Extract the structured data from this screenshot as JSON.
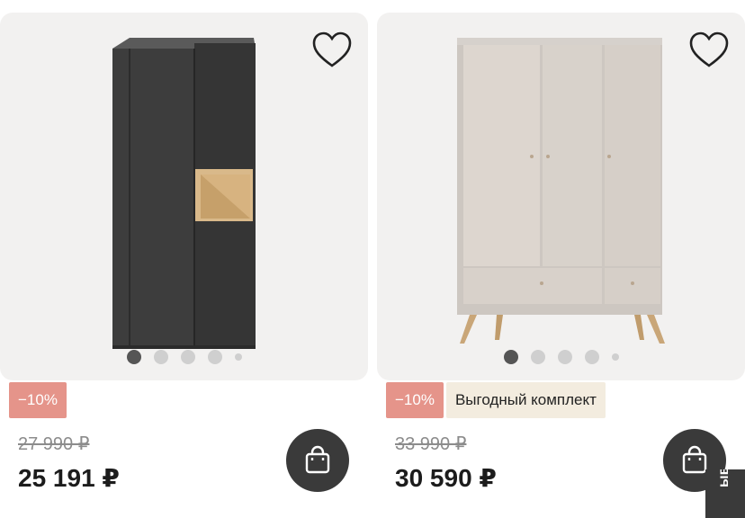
{
  "products": [
    {
      "image_icon": "dark-wardrobe-with-oak-niche",
      "favorite_icon": "heart-outline-icon",
      "carousel": {
        "count": 5,
        "active": 1
      },
      "badges": [
        "−10%"
      ],
      "old_price": "27 990 ₽",
      "price": "25 191 ₽",
      "cart_icon": "shopping-bag-icon"
    },
    {
      "image_icon": "beige-three-door-wardrobe",
      "favorite_icon": "heart-outline-icon",
      "carousel": {
        "count": 5,
        "active": 1
      },
      "badges": [
        "−10%",
        "Выгодный комплект"
      ],
      "old_price": "33 990 ₽",
      "price": "30 590 ₽",
      "cart_icon": "shopping-bag-icon"
    }
  ],
  "side_tab": {
    "label": "ыв"
  },
  "colors": {
    "discount_badge": "#e5948a",
    "promo_badge": "#f3ecdf",
    "cart_button": "#3a3a3a",
    "image_bg": "#f2f1f0"
  }
}
